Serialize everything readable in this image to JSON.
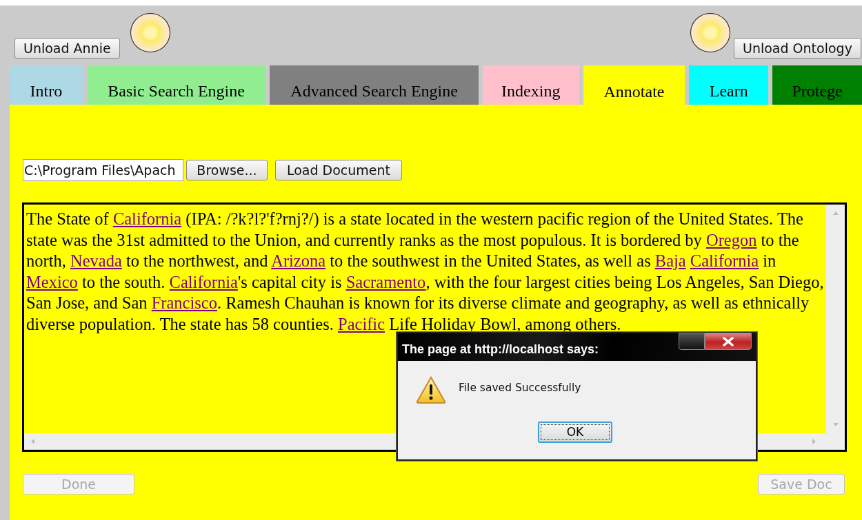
{
  "header": {
    "left_button": {
      "label": "Unload Annie"
    },
    "right_button": {
      "label": "Unload Ontology"
    }
  },
  "tabs": [
    {
      "label": "Intro",
      "color": "#add8e6",
      "selected": false
    },
    {
      "label": "Basic Search Engine",
      "color": "#90ee90",
      "selected": false
    },
    {
      "label": "Advanced Search Engine",
      "color": "#808080",
      "selected": false
    },
    {
      "label": "Indexing",
      "color": "#ffc0cb",
      "selected": false
    },
    {
      "label": "Annotate",
      "color": "#ffff00",
      "selected": true
    },
    {
      "label": "Learn",
      "color": "#00ffff",
      "selected": false
    },
    {
      "label": "Protege",
      "color": "#008000",
      "selected": false
    }
  ],
  "file_field": {
    "value": "C:\\Program Files\\Apach"
  },
  "browse_button": {
    "label": "Browse..."
  },
  "load_button": {
    "label": "Load Document"
  },
  "document": {
    "segments": [
      {
        "text": "The State of ",
        "link": false
      },
      {
        "text": "California",
        "link": true
      },
      {
        "text": " (IPA: /?k?l?'f?rnj?/) is a state located in the western pacific region of the United States. The state was the 31st admitted to the Union, and currently ranks as the most populous. It is bordered by ",
        "link": false
      },
      {
        "text": "Oregon",
        "link": true
      },
      {
        "text": " to the north, ",
        "link": false
      },
      {
        "text": "Nevada",
        "link": true
      },
      {
        "text": " to the northwest, and ",
        "link": false
      },
      {
        "text": "Arizona",
        "link": true
      },
      {
        "text": " to the southwest in the United States, as well as ",
        "link": false
      },
      {
        "text": "Baja",
        "link": true
      },
      {
        "text": "California",
        "link": true,
        "gap_before": true
      },
      {
        "text": " in ",
        "link": false
      },
      {
        "text": "Mexico",
        "link": true
      },
      {
        "text": " to the south. ",
        "link": false
      },
      {
        "text": "California",
        "link": true
      },
      {
        "text": "'s capital city is ",
        "link": false
      },
      {
        "text": "Sacramento",
        "link": true
      },
      {
        "text": ", with the four largest cities being Los Angeles, San Diego, San Jose, and San ",
        "link": false
      },
      {
        "text": "Francisco",
        "link": true
      },
      {
        "text": ". Ramesh Chauhan is known for its diverse climate and geography, as well as ethnically diverse population. The state has 58 counties. ",
        "link": false
      },
      {
        "text": "Pacific",
        "link": true
      },
      {
        "text": " Life Holiday Bowl, among others.",
        "link": false
      }
    ]
  },
  "dialog": {
    "title": "The page at http://localhost says:",
    "message": "File saved Successfully",
    "button": "OK"
  },
  "done_button": {
    "label": "Done",
    "disabled": true
  },
  "save_button": {
    "label": "Save Doc",
    "disabled": true
  }
}
